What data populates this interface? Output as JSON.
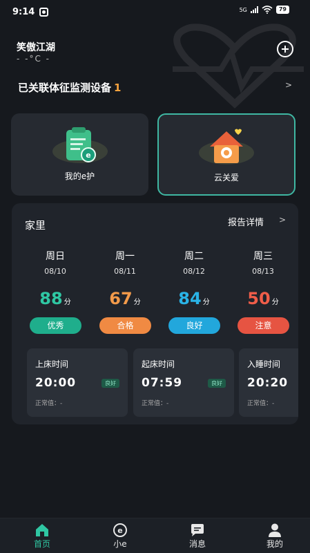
{
  "status_bar": {
    "time": "9:14",
    "network": "5G",
    "battery": "79"
  },
  "header": {
    "location": "笑傲江湖",
    "temperature": "- -°C -"
  },
  "device_row": {
    "label": "已关联体征监测设备",
    "count": "1"
  },
  "cards": [
    {
      "label": "我的e护",
      "icon": "clipboard-icon"
    },
    {
      "label": "云关爱",
      "icon": "house-heart-icon"
    }
  ],
  "home_panel": {
    "title": "家里",
    "report_link": "报告详情",
    "days": [
      {
        "name": "周日",
        "date": "08/10",
        "score": "88",
        "unit": "分",
        "status": "优秀",
        "score_color": "#2fc7a3",
        "badge_color": "#1fae8c"
      },
      {
        "name": "周一",
        "date": "08/11",
        "score": "67",
        "unit": "分",
        "status": "合格",
        "score_color": "#f29a4a",
        "badge_color": "#f08a43"
      },
      {
        "name": "周二",
        "date": "08/12",
        "score": "84",
        "unit": "分",
        "status": "良好",
        "score_color": "#2ab3e6",
        "badge_color": "#22a7dc"
      },
      {
        "name": "周三",
        "date": "08/13",
        "score": "50",
        "unit": "分",
        "status": "注意",
        "score_color": "#ef5d49",
        "badge_color": "#e65442"
      }
    ],
    "stats": [
      {
        "title": "上床时间",
        "value": "20:00",
        "badge": "良好",
        "normal": "正常值：-"
      },
      {
        "title": "起床时间",
        "value": "07:59",
        "badge": "良好",
        "normal": "正常值：-"
      },
      {
        "title": "入睡时间",
        "value": "20:20",
        "badge": "",
        "normal": "正常值：-"
      }
    ]
  },
  "nav": [
    {
      "label": "首页",
      "icon": "home-icon",
      "active": true
    },
    {
      "label": "小e",
      "icon": "e-logo-icon",
      "active": false
    },
    {
      "label": "消息",
      "icon": "message-icon",
      "active": false
    },
    {
      "label": "我的",
      "icon": "user-icon",
      "active": false
    }
  ],
  "colors": {
    "accent": "#2fc7a3",
    "highlight": "#f7a33e",
    "panel": "#20242b"
  }
}
